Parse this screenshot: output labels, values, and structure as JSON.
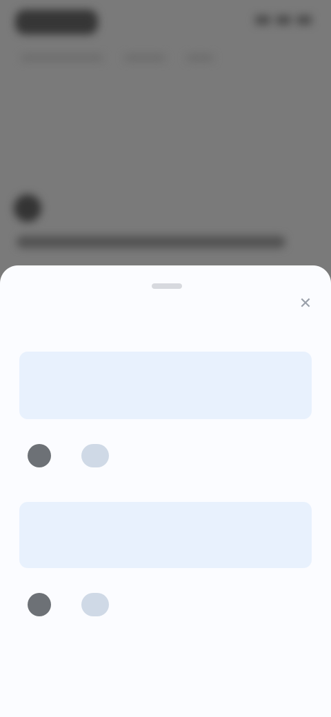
{
  "background": {
    "status_icons": [
      "signal-icon",
      "wifi-icon",
      "battery-icon"
    ]
  },
  "sheet": {
    "title": "",
    "close_icon": "✕",
    "items": [
      {
        "text": "",
        "avatar_glyph": "",
        "translate_glyph": "",
        "status": ""
      },
      {
        "text": "",
        "avatar_glyph": "",
        "translate_glyph": "",
        "status": ""
      }
    ]
  },
  "colors": {
    "sheet_background": "#fbfcff",
    "card_background": "#e8f1fd",
    "card_text": "#5e86c7",
    "status_text": "#e08b6b"
  }
}
